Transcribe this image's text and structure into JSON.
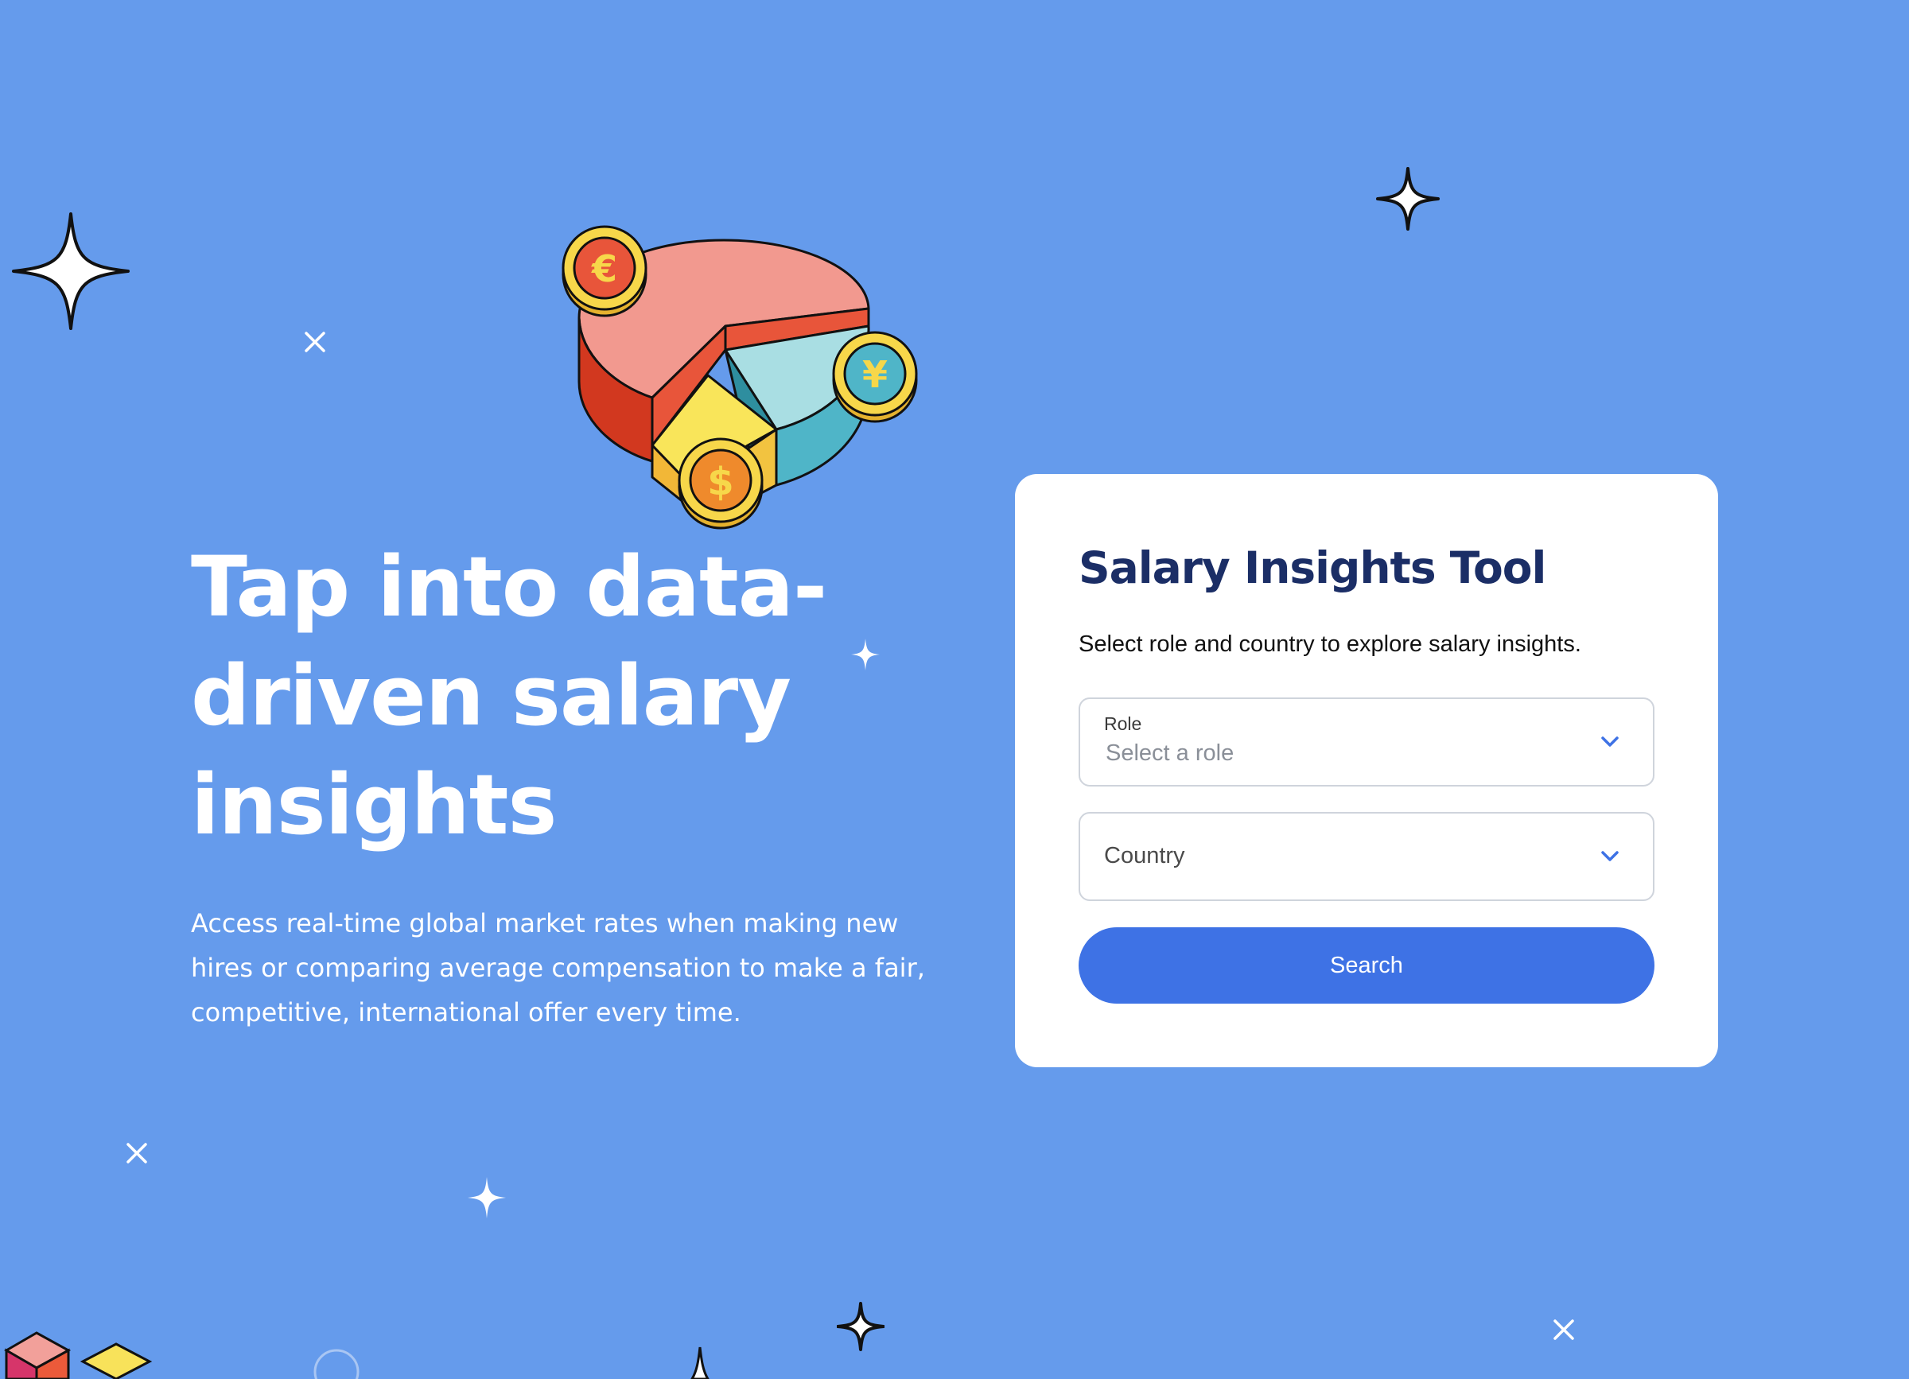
{
  "hero": {
    "title": "Tap into data-\ndriven salary\ninsights",
    "description": "Access real-time global market rates when making new hires or comparing average compensation to make a fair, competitive, international offer every time."
  },
  "tool": {
    "title": "Salary Insights Tool",
    "subtitle": "Select role and country to explore salary insights.",
    "role": {
      "label": "Role",
      "placeholder": "Select a role"
    },
    "country": {
      "label": "Country"
    },
    "search_label": "Search"
  },
  "illustration": {
    "coin_symbols": [
      "€",
      "¥",
      "$"
    ]
  },
  "icons": {
    "role_chevron": "chevron-down-icon",
    "country_chevron": "chevron-down-icon",
    "sparkle": "sparkle-icon"
  },
  "colors": {
    "background": "#659BEC",
    "card_title": "#1B2E66",
    "button": "#3E72E5",
    "chevron": "#3E72E5"
  }
}
